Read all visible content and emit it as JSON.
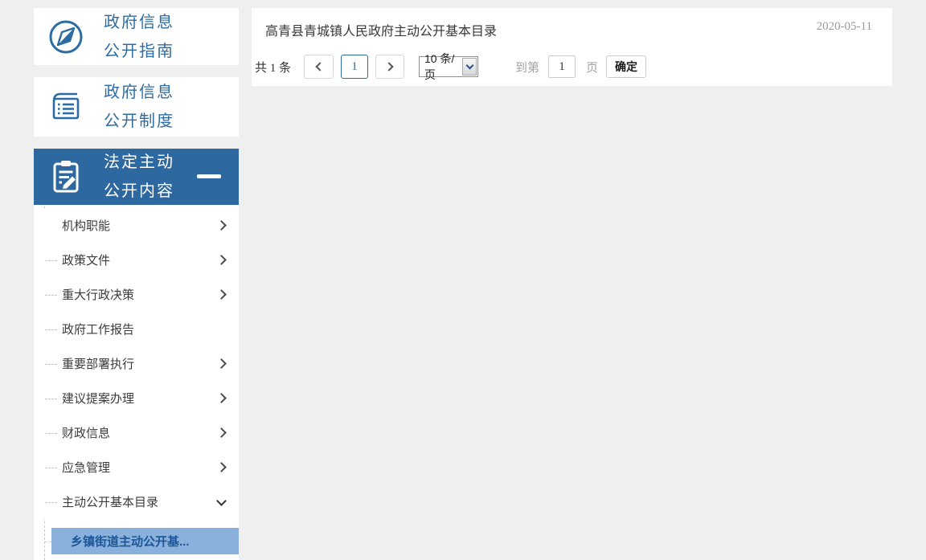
{
  "colors": {
    "accent": "#2d6ca2",
    "active_bg": "#2e68a0",
    "highlight_bg": "#8ab1db",
    "highlight_text": "#1c5698",
    "page_bg": "#efefef"
  },
  "sidebar": {
    "cards": [
      {
        "line1": "政府信息",
        "line2": "公开指南",
        "icon": "compass-icon"
      },
      {
        "line1": "政府信息",
        "line2": "公开制度",
        "icon": "ledger-icon"
      }
    ],
    "active_card": {
      "line1": "法定主动",
      "line2": "公开内容",
      "icon": "clipboard-pencil-icon",
      "state_icon": "minus-icon"
    },
    "submenu": [
      {
        "label": "机构职能",
        "chevron": "right",
        "connector": false
      },
      {
        "label": "政策文件",
        "chevron": "right",
        "connector": true
      },
      {
        "label": "重大行政决策",
        "chevron": "right",
        "connector": true
      },
      {
        "label": "政府工作报告",
        "chevron": "none",
        "connector": true
      },
      {
        "label": "重要部署执行",
        "chevron": "right",
        "connector": true
      },
      {
        "label": "建议提案办理",
        "chevron": "right",
        "connector": true
      },
      {
        "label": "财政信息",
        "chevron": "right",
        "connector": true
      },
      {
        "label": "应急管理",
        "chevron": "right",
        "connector": true
      },
      {
        "label": "主动公开基本目录",
        "chevron": "down",
        "connector": true
      }
    ],
    "active_child": {
      "label": "乡镇街道主动公开基..."
    }
  },
  "content": {
    "list_item": {
      "title": "高青县青城镇人民政府主动公开基本目录",
      "date": "2020-05-11"
    },
    "pagination": {
      "total": "共 1 条",
      "prev_icon": "chevron-left-icon",
      "current_page": "1",
      "next_icon": "chevron-right-icon",
      "page_size": "10 条/页",
      "page_size_arrow": "dropdown-arrow-icon",
      "goto_label": "到第",
      "goto_value": "1",
      "goto_unit": "页",
      "confirm_label": "确定"
    }
  }
}
